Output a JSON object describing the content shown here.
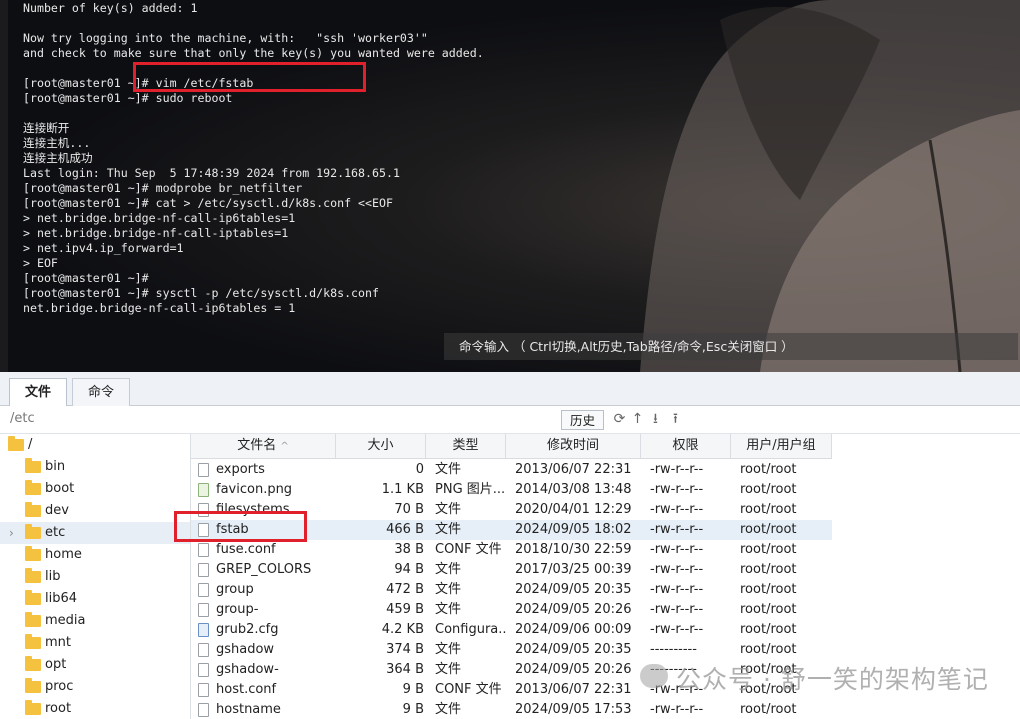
{
  "terminal": {
    "lines": [
      "Number of key(s) added: 1",
      "",
      "Now try logging into the machine, with:   \"ssh 'worker03'\"",
      "and check to make sure that only the key(s) you wanted were added.",
      "",
      "[root@master01 ~]# vim /etc/fstab",
      "[root@master01 ~]# sudo reboot",
      "",
      "连接断开",
      "连接主机...",
      "连接主机成功",
      "Last login: Thu Sep  5 17:48:39 2024 from 192.168.65.1",
      "[root@master01 ~]# modprobe br_netfilter",
      "[root@master01 ~]# cat > /etc/sysctl.d/k8s.conf <<EOF",
      "> net.bridge.bridge-nf-call-ip6tables=1",
      "> net.bridge.bridge-nf-call-iptables=1",
      "> net.ipv4.ip_forward=1",
      "> EOF",
      "[root@master01 ~]#",
      "[root@master01 ~]# sysctl -p /etc/sysctl.d/k8s.conf",
      "net.bridge.bridge-nf-call-ip6tables = 1"
    ],
    "hint": "命令输入 （ Ctrl切换,Alt历史,Tab路径/命令,Esc关闭窗口 ）"
  },
  "tabs": {
    "files": "文件",
    "command": "命令"
  },
  "pathbar": {
    "path": "/etc",
    "history_label": "历史"
  },
  "tree": {
    "root": "/",
    "items": [
      {
        "label": "bin"
      },
      {
        "label": "boot"
      },
      {
        "label": "dev"
      },
      {
        "label": "etc",
        "selected": true
      },
      {
        "label": "home"
      },
      {
        "label": "lib"
      },
      {
        "label": "lib64"
      },
      {
        "label": "media"
      },
      {
        "label": "mnt"
      },
      {
        "label": "opt"
      },
      {
        "label": "proc"
      },
      {
        "label": "root"
      }
    ]
  },
  "table": {
    "columns": [
      "文件名",
      "大小",
      "类型",
      "修改时间",
      "权限",
      "用户/用户组"
    ],
    "rows": [
      {
        "name": "exports",
        "size": "0",
        "type": "文件",
        "mtime": "2013/06/07 22:31",
        "perm": "-rw-r--r--",
        "owner": "root/root",
        "icon": "file"
      },
      {
        "name": "favicon.png",
        "size": "1.1 KB",
        "type": "PNG 图片...",
        "mtime": "2014/03/08 13:48",
        "perm": "-rw-r--r--",
        "owner": "root/root",
        "icon": "image"
      },
      {
        "name": "filesystems",
        "size": "70 B",
        "type": "文件",
        "mtime": "2020/04/01 12:29",
        "perm": "-rw-r--r--",
        "owner": "root/root",
        "icon": "file"
      },
      {
        "name": "fstab",
        "size": "466 B",
        "type": "文件",
        "mtime": "2024/09/05 18:02",
        "perm": "-rw-r--r--",
        "owner": "root/root",
        "icon": "file",
        "selected": true
      },
      {
        "name": "fuse.conf",
        "size": "38 B",
        "type": "CONF 文件",
        "mtime": "2018/10/30 22:59",
        "perm": "-rw-r--r--",
        "owner": "root/root",
        "icon": "file"
      },
      {
        "name": "GREP_COLORS",
        "size": "94 B",
        "type": "文件",
        "mtime": "2017/03/25 00:39",
        "perm": "-rw-r--r--",
        "owner": "root/root",
        "icon": "file"
      },
      {
        "name": "group",
        "size": "472 B",
        "type": "文件",
        "mtime": "2024/09/05 20:35",
        "perm": "-rw-r--r--",
        "owner": "root/root",
        "icon": "file"
      },
      {
        "name": "group-",
        "size": "459 B",
        "type": "文件",
        "mtime": "2024/09/05 20:26",
        "perm": "-rw-r--r--",
        "owner": "root/root",
        "icon": "file"
      },
      {
        "name": "grub2.cfg",
        "size": "4.2 KB",
        "type": "Configura...",
        "mtime": "2024/09/06 00:09",
        "perm": "-rw-r--r--",
        "owner": "root/root",
        "icon": "config"
      },
      {
        "name": "gshadow",
        "size": "374 B",
        "type": "文件",
        "mtime": "2024/09/05 20:35",
        "perm": "----------",
        "owner": "root/root",
        "icon": "file"
      },
      {
        "name": "gshadow-",
        "size": "364 B",
        "type": "文件",
        "mtime": "2024/09/05 20:26",
        "perm": "----------",
        "owner": "root/root",
        "icon": "file"
      },
      {
        "name": "host.conf",
        "size": "9 B",
        "type": "CONF 文件",
        "mtime": "2013/06/07 22:31",
        "perm": "-rw-r--r--",
        "owner": "root/root",
        "icon": "file"
      },
      {
        "name": "hostname",
        "size": "9 B",
        "type": "文件",
        "mtime": "2024/09/05 17:53",
        "perm": "-rw-r--r--",
        "owner": "root/root",
        "icon": "file"
      }
    ]
  },
  "watermark": "公众号 · 舒一笑的架构笔记",
  "colors": {
    "highlight_box": "#e0212b",
    "terminal_bg": "#0e0f13",
    "selected_row": "#e6eef7",
    "folder": "#f4c23f"
  }
}
